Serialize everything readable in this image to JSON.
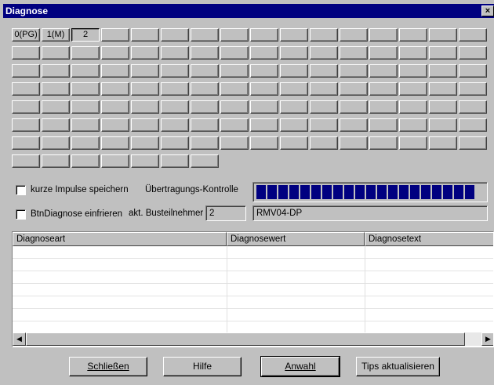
{
  "window": {
    "title": "Diagnose",
    "close_glyph": "×"
  },
  "grid": {
    "first_row_labels": [
      "0(PG)",
      "1(M)",
      "2"
    ],
    "pressed_index": 2,
    "total_cells": 119
  },
  "options": {
    "kurze_impulse": {
      "label": "kurze Impulse speichern",
      "checked": false
    },
    "btn_diagnose": {
      "label": "BtnDiagnose einfrieren",
      "checked": false
    }
  },
  "uebertragung": {
    "label": "Übertragungs-Kontrolle",
    "progress_percent": 100,
    "segments": 20
  },
  "busteilnehmer": {
    "label": "akt. Busteilnehmer",
    "value": "2",
    "device": "RMV04-DP"
  },
  "table": {
    "columns": [
      "Diagnoseart",
      "Diagnosewert",
      "Diagnosetext"
    ],
    "rows": []
  },
  "buttons": {
    "schliessen": "Schließen",
    "hilfe": "Hilfe",
    "anwahl": "Anwahl",
    "tips": "Tips aktualisieren"
  },
  "colors": {
    "titlebar": "#000080",
    "progress": "#000080",
    "face": "#c0c0c0"
  }
}
